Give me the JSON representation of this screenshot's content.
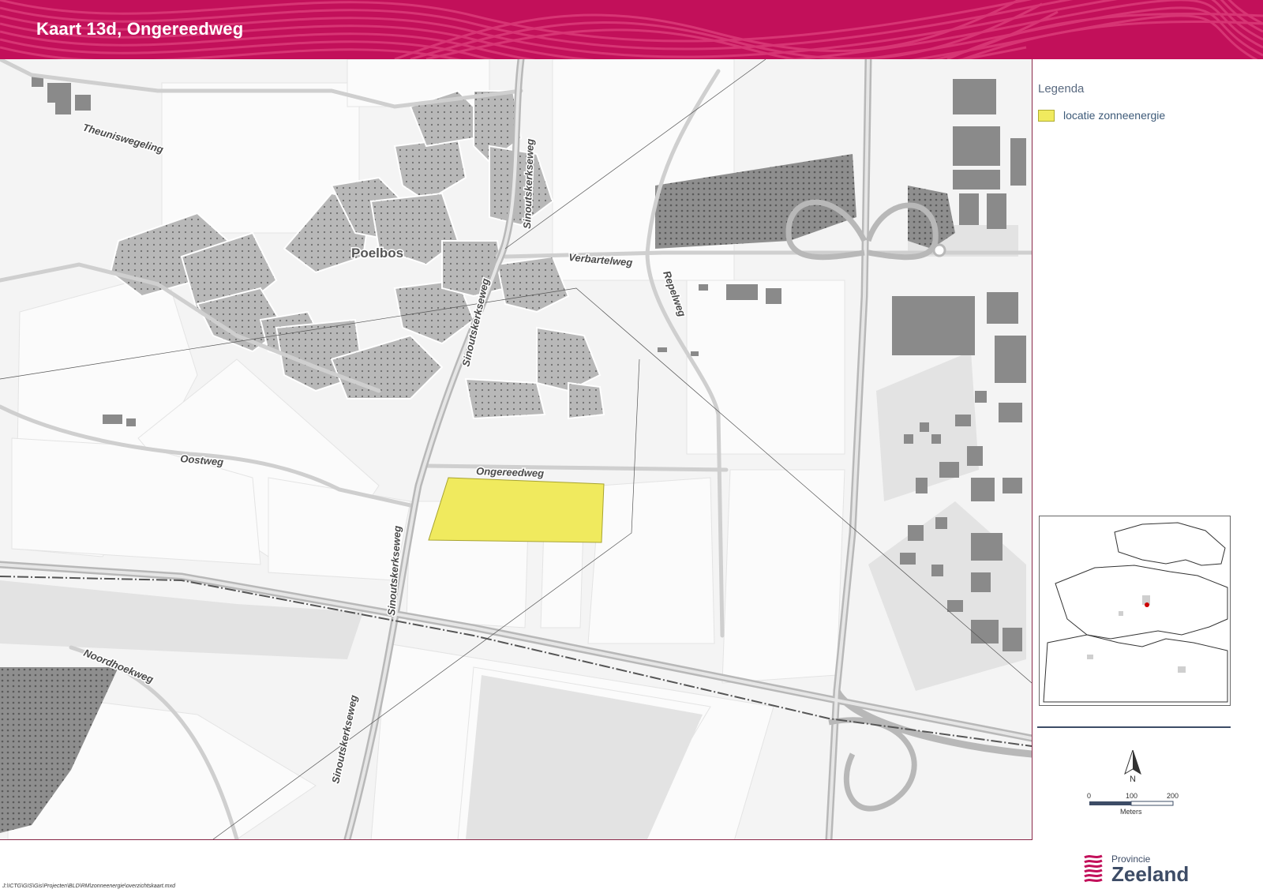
{
  "header": {
    "title": "Kaart 13d, Ongereedweg"
  },
  "map": {
    "place_label": "Poelbos",
    "roads": {
      "theuniswegeling": "Theuniswegeling",
      "sinoutskerkseweg": "Sinoutskerkseweg",
      "verbartelweg": "Verbartelweg",
      "repelweg": "Repelweg",
      "oostweg": "Oostweg",
      "ongereedweg": "Ongereedweg",
      "noordhoekweg": "Noordhoekweg"
    },
    "highlight_color": "#f0ea5e"
  },
  "legend": {
    "title": "Legenda",
    "items": [
      {
        "label": "locatie zonneenergie",
        "color": "#f0ea5e"
      }
    ]
  },
  "north_arrow": {
    "label": "N"
  },
  "scale": {
    "ticks": [
      "0",
      "100",
      "200"
    ],
    "unit": "Meters"
  },
  "logo": {
    "line1": "Provincie",
    "line2": "Zeeland"
  },
  "footer": {
    "filepath": "J:\\ICTG\\GIS\\Gis\\Projecten\\BLD\\RM\\zonneenergie\\overzichtskaart.mxd"
  },
  "colors": {
    "brand": "#c2105a",
    "navy": "#3d4c66"
  }
}
